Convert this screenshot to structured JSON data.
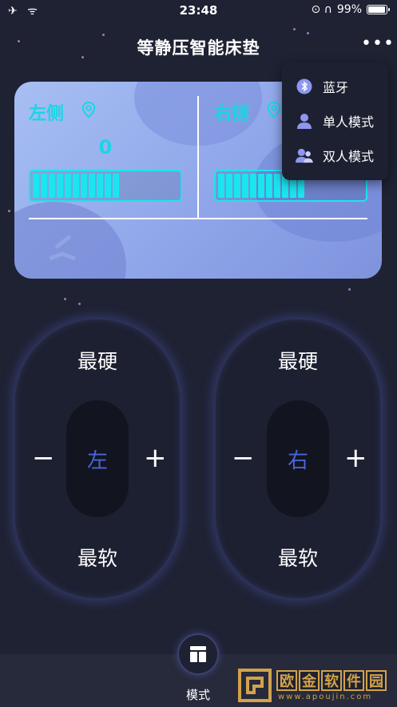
{
  "status_bar": {
    "left_icons": "✈ ᯤ",
    "time": "23:48",
    "right_icons": "⊙ ∩",
    "battery": "99%"
  },
  "nav": {
    "title": "等静压智能床垫",
    "more": "•••"
  },
  "left_panel": {
    "label": "左侧",
    "value": "0",
    "level_fraction": 0.63
  },
  "right_panel": {
    "label": "右侧",
    "level_fraction": 0.61
  },
  "menu": {
    "items": [
      {
        "label": "蓝牙",
        "icon": "bluetooth-icon"
      },
      {
        "label": "单人模式",
        "icon": "single-person-icon"
      },
      {
        "label": "双人模式",
        "icon": "double-person-icon"
      }
    ]
  },
  "left_control": {
    "top": "最硬",
    "center": "左",
    "bottom": "最软",
    "minus": "−",
    "plus": "+"
  },
  "right_control": {
    "top": "最硬",
    "center": "右",
    "bottom": "最软",
    "minus": "−",
    "plus": "+"
  },
  "bottom": {
    "mode_label": "模式"
  },
  "watermark": {
    "chars": [
      "欧",
      "金",
      "软",
      "件",
      "园"
    ],
    "url": "www.apoujin.com"
  },
  "colors": {
    "accent_cyan": "#19e6f0",
    "center_blue": "#4b63d8",
    "menu_icon": "#8e96f0"
  }
}
